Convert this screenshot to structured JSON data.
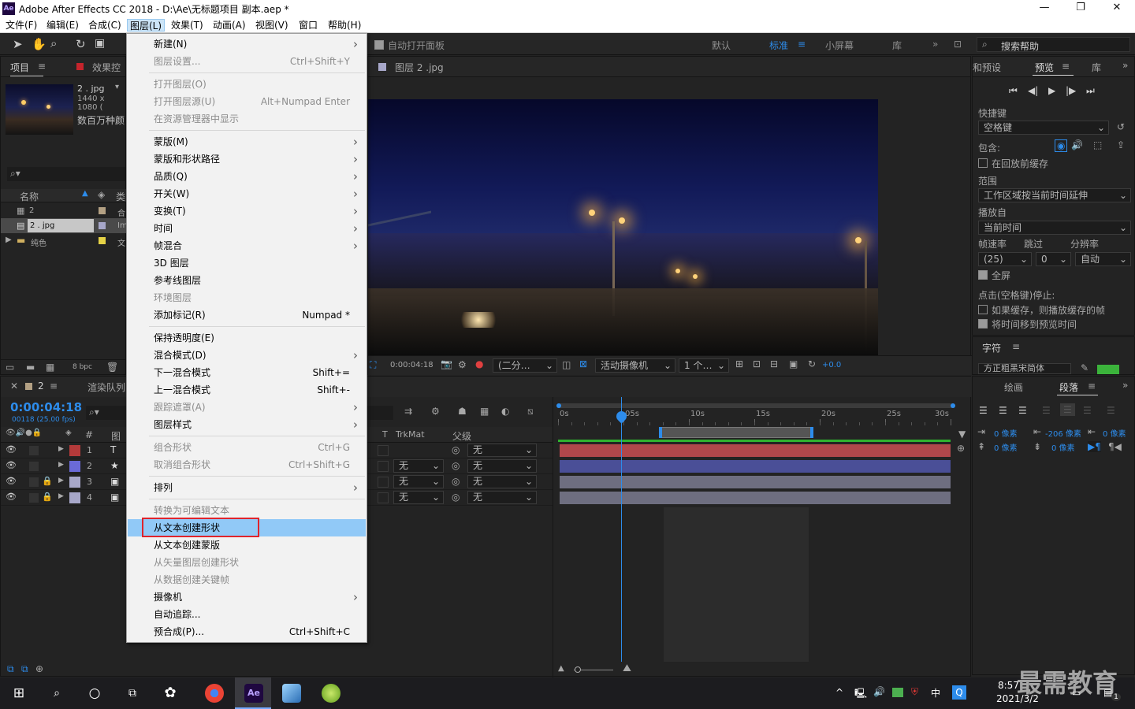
{
  "window": {
    "title": "Adobe After Effects CC 2018 - D:\\Ae\\无标题项目 副本.aep *",
    "logo": "Ae",
    "min": "—",
    "max": "❐",
    "close": "✕"
  },
  "menubar": [
    "文件(F)",
    "编辑(E)",
    "合成(C)",
    "图层(L)",
    "效果(T)",
    "动画(A)",
    "视图(V)",
    "窗口",
    "帮助(H)"
  ],
  "toolbar": {
    "auto_open": "自动打开面板",
    "workspaces": [
      "默认",
      "标准",
      "小屏幕",
      "库"
    ],
    "search_placeholder": "搜索帮助",
    "more": "»"
  },
  "project": {
    "tab_project": "项目",
    "tab_effects": "效果控",
    "item_name": "2 . jpg",
    "item_size": "1440 x 1080 (",
    "item_desc": "数百万种颜",
    "col_name": "名称",
    "col_type": "类",
    "rows": [
      {
        "name": "2",
        "type": "合"
      },
      {
        "name": "2 . jpg",
        "type": "Im"
      },
      {
        "name": "纯色",
        "type": "文"
      }
    ],
    "bpc": "8 bpc"
  },
  "viewer": {
    "tab": "图层 2 .jpg",
    "timecode": "0:00:04:18",
    "resolution": "(二分…",
    "camera": "活动摄像机",
    "views": "1 个…",
    "exposure": "+0.0"
  },
  "right_panel": {
    "tab_presets": "和预设",
    "tab_preview": "预览",
    "tab_lib": "库",
    "shortcut_label": "快捷键",
    "shortcut_value": "空格键",
    "include_label": "包含:",
    "cache_before": "在回放前缓存",
    "range_label": "范围",
    "range_value": "工作区域按当前时间延伸",
    "play_from_label": "播放自",
    "play_from_value": "当前时间",
    "fps_label": "帧速率",
    "skip_label": "跳过",
    "res_label": "分辨率",
    "fps_value": "(25)",
    "skip_value": "0",
    "res_value": "自动",
    "fullscreen": "全屏",
    "stop_note": "点击(空格键)停止:",
    "if_cached": "如果缓存，则播放缓存的帧",
    "move_time": "将时间移到预览时间",
    "char_tab": "字符",
    "font_value": "方正粗黑宋简体"
  },
  "para_panel": {
    "tab_draw": "绘画",
    "tab_para": "段落",
    "indent_left": "0 像素",
    "indent_right": "0 像素",
    "first_indent": "-206 像素",
    "space_before": "0 像素",
    "space_after": "0 像素"
  },
  "timeline": {
    "tab_comp": "2",
    "tab_render": "渲染队列",
    "timecode": "0:00:04:18",
    "frames": "00118 (25.00 fps)",
    "col_num": "#",
    "col_src": "图",
    "col_trkmat": "TrkMat",
    "col_parent": "父级",
    "ruler": [
      "0s",
      "05s",
      "10s",
      "15s",
      "20s",
      "25s",
      "30s"
    ],
    "layers": [
      {
        "num": "1",
        "icon": "T",
        "color": "#b33a3a",
        "trk": "",
        "parent": "无"
      },
      {
        "num": "2",
        "icon": "★",
        "color": "#6a6ad8",
        "trk": "无",
        "parent": "无"
      },
      {
        "num": "3",
        "icon": "▣",
        "color": "#a7a7c9",
        "trk": "无",
        "parent": "无"
      },
      {
        "num": "4",
        "icon": "▣",
        "color": "#a7a7c9",
        "trk": "无",
        "parent": "无"
      }
    ],
    "bar_colors": [
      "#b0474b",
      "#4a4f97",
      "#6e6e80",
      "#6e6e80"
    ]
  },
  "menu": [
    {
      "label": "新建(N)",
      "shortcut": "",
      "arrow": true,
      "disabled": false
    },
    {
      "label": "图层设置...",
      "shortcut": "Ctrl+Shift+Y",
      "arrow": false,
      "disabled": true
    },
    {
      "sep": true
    },
    {
      "label": "打开图层(O)",
      "shortcut": "",
      "arrow": false,
      "disabled": true
    },
    {
      "label": "打开图层源(U)",
      "shortcut": "Alt+Numpad Enter",
      "arrow": false,
      "disabled": true
    },
    {
      "label": "在资源管理器中显示",
      "shortcut": "",
      "arrow": false,
      "disabled": true
    },
    {
      "sep": true
    },
    {
      "label": "蒙版(M)",
      "shortcut": "",
      "arrow": true,
      "disabled": false
    },
    {
      "label": "蒙版和形状路径",
      "shortcut": "",
      "arrow": true,
      "disabled": false
    },
    {
      "label": "品质(Q)",
      "shortcut": "",
      "arrow": true,
      "disabled": false
    },
    {
      "label": "开关(W)",
      "shortcut": "",
      "arrow": true,
      "disabled": false
    },
    {
      "label": "变换(T)",
      "shortcut": "",
      "arrow": true,
      "disabled": false
    },
    {
      "label": "时间",
      "shortcut": "",
      "arrow": true,
      "disabled": false
    },
    {
      "label": "帧混合",
      "shortcut": "",
      "arrow": true,
      "disabled": false
    },
    {
      "label": "3D 图层",
      "shortcut": "",
      "arrow": false,
      "disabled": false
    },
    {
      "label": "参考线图层",
      "shortcut": "",
      "arrow": false,
      "disabled": false
    },
    {
      "label": "环境图层",
      "shortcut": "",
      "arrow": false,
      "disabled": true
    },
    {
      "label": "添加标记(R)",
      "shortcut": "Numpad *",
      "arrow": false,
      "disabled": false
    },
    {
      "sep": true
    },
    {
      "label": "保持透明度(E)",
      "shortcut": "",
      "arrow": false,
      "disabled": false
    },
    {
      "label": "混合模式(D)",
      "shortcut": "",
      "arrow": true,
      "disabled": false
    },
    {
      "label": "下一混合模式",
      "shortcut": "Shift+=",
      "arrow": false,
      "disabled": false
    },
    {
      "label": "上一混合模式",
      "shortcut": "Shift+-",
      "arrow": false,
      "disabled": false
    },
    {
      "label": "跟踪遮罩(A)",
      "shortcut": "",
      "arrow": true,
      "disabled": true
    },
    {
      "label": "图层样式",
      "shortcut": "",
      "arrow": true,
      "disabled": false
    },
    {
      "sep": true
    },
    {
      "label": "组合形状",
      "shortcut": "Ctrl+G",
      "arrow": false,
      "disabled": true
    },
    {
      "label": "取消组合形状",
      "shortcut": "Ctrl+Shift+G",
      "arrow": false,
      "disabled": true
    },
    {
      "sep": true
    },
    {
      "label": "排列",
      "shortcut": "",
      "arrow": true,
      "disabled": false
    },
    {
      "sep": true
    },
    {
      "label": "转换为可编辑文本",
      "shortcut": "",
      "arrow": false,
      "disabled": true
    },
    {
      "label": "从文本创建形状",
      "shortcut": "",
      "arrow": false,
      "disabled": false,
      "highlighted": true
    },
    {
      "label": "从文本创建蒙版",
      "shortcut": "",
      "arrow": false,
      "disabled": false
    },
    {
      "label": "从矢量图层创建形状",
      "shortcut": "",
      "arrow": false,
      "disabled": true
    },
    {
      "label": "从数据创建关键帧",
      "shortcut": "",
      "arrow": false,
      "disabled": true
    },
    {
      "label": "摄像机",
      "shortcut": "",
      "arrow": true,
      "disabled": false
    },
    {
      "label": "自动追踪...",
      "shortcut": "",
      "arrow": false,
      "disabled": false
    },
    {
      "label": "预合成(P)...",
      "shortcut": "Ctrl+Shift+C",
      "arrow": false,
      "disabled": false
    }
  ],
  "taskbar": {
    "time": "8:57",
    "date": "2021/3/2",
    "ime": "中",
    "notif": "1",
    "watermark": "最需教育"
  },
  "colors": {
    "accent": "#2d8ceb",
    "highlight": "#91c9f7",
    "red_box": "#e0242c"
  }
}
